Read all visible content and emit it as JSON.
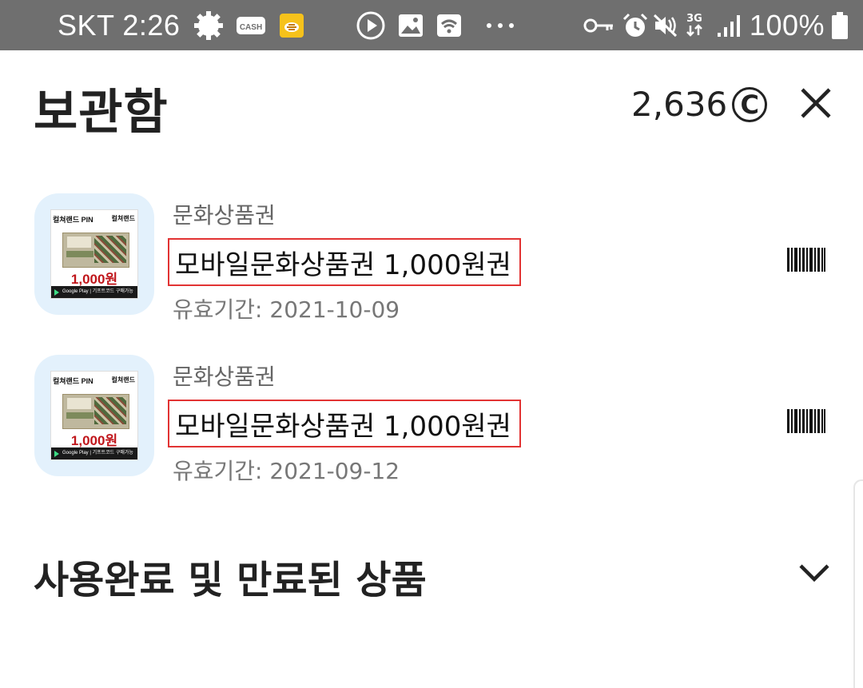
{
  "status_bar": {
    "carrier_time": "SKT 2:26",
    "cash_icon_label": "CASH",
    "network": "3G",
    "battery": "100%",
    "icons": [
      "gear-icon",
      "cash-icon",
      "bee-icon",
      "play-icon",
      "image-icon",
      "wifi-icon",
      "more-icon",
      "key-icon",
      "alarm-icon",
      "mute-icon",
      "network-3g-icon",
      "signal-icon",
      "battery-icon"
    ]
  },
  "header": {
    "title": "보관함",
    "points": "2,636",
    "coin_symbol": "C"
  },
  "items": [
    {
      "category": "문화상품권",
      "name": "모바일문화상품권 1,000원권",
      "expiry": "유효기간: 2021-10-09",
      "card": {
        "brand": "컬쳐랜드 PIN",
        "brand_right": "컬쳐랜드",
        "price": "1,000원",
        "footer": "Google Play | 기프트코드 구매가능"
      }
    },
    {
      "category": "문화상품권",
      "name": "모바일문화상품권 1,000원권",
      "expiry": "유효기간: 2021-09-12",
      "card": {
        "brand": "컬쳐랜드 PIN",
        "brand_right": "컬쳐랜드",
        "price": "1,000원",
        "footer": "Google Play | 기프트코드 구매가능"
      }
    }
  ],
  "section": {
    "title": "사용완료 및 만료된 상품"
  },
  "colors": {
    "status_bar_bg": "#6f6f6f",
    "thumb_bg": "#e3f1fc",
    "highlight_border": "#e23333",
    "price_red": "#c0161b"
  }
}
